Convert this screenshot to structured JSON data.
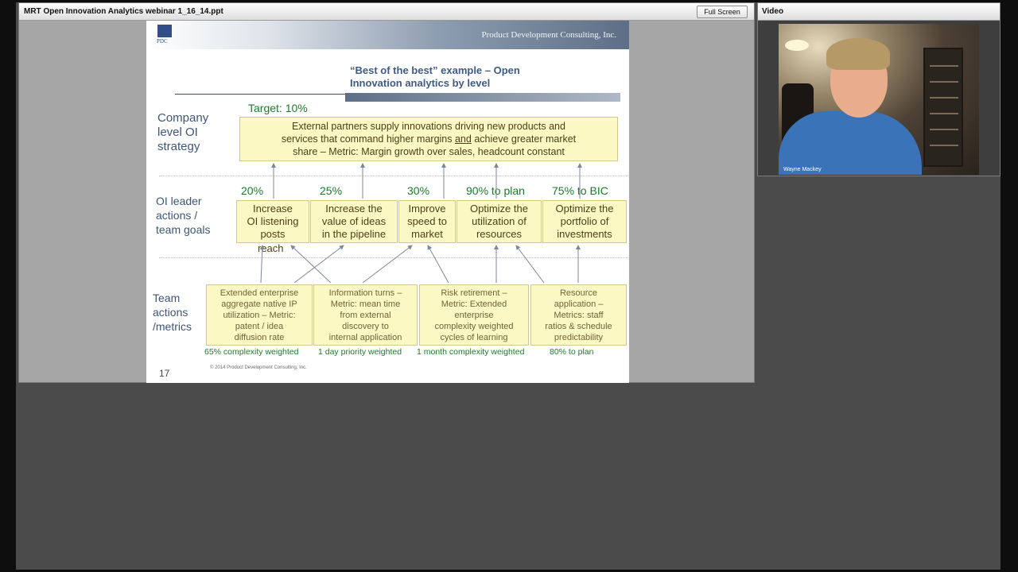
{
  "presentation_pod": {
    "title": "MRT Open Innovation Analytics webinar 1_16_14.ppt",
    "fullscreen_label": "Full Screen"
  },
  "slide": {
    "logo_text": "PDC",
    "company": "Product Development Consulting, Inc.",
    "title_line1": "“Best of the best” example – Open",
    "title_line2": "Innovation analytics by level",
    "row1_label": [
      "Company",
      "level OI",
      "strategy"
    ],
    "row2_label": [
      "OI leader",
      "actions /",
      "team goals"
    ],
    "row3_label": [
      "Team",
      "actions",
      "/metrics"
    ],
    "target": "Target: 10%",
    "strategy_box": [
      "External partners supply innovations driving new products and",
      "services that command higher margins and achieve greater market",
      "share – Metric: Margin growth over sales, headcount constant"
    ],
    "strategy_box_parts": {
      "line2_pre": "services that command higher margins ",
      "line2_underlined": "and",
      "line2_post": " achieve greater market"
    },
    "goal_percents": [
      "20%",
      "25%",
      "30%",
      "90% to plan",
      "75% to BIC"
    ],
    "goal_boxes": [
      [
        "Increase",
        "OI listening",
        "posts"
      ],
      [
        "Increase the",
        "value of ideas",
        "in the pipeline"
      ],
      [
        "Improve",
        "speed to",
        "market"
      ],
      [
        "Optimize the",
        "utilization of",
        "resources"
      ],
      [
        "Optimize the",
        "portfolio of",
        "investments"
      ]
    ],
    "stray_word": "reach",
    "action_boxes": [
      [
        "Extended enterprise",
        "aggregate native IP",
        "utilization – Metric:",
        "patent / idea",
        "diffusion rate"
      ],
      [
        "Information turns –",
        "Metric: mean time",
        "from external",
        "discovery to",
        "internal application"
      ],
      [
        "Risk retirement –",
        "Metric: Extended",
        "enterprise",
        "complexity weighted",
        "cycles of learning"
      ],
      [
        "Resource",
        "application –",
        "Metrics: staff",
        "ratios & schedule",
        "predictability"
      ]
    ],
    "action_metrics": [
      "65% complexity weighted",
      "1 day priority weighted",
      "1 month complexity weighted",
      "80% to plan"
    ],
    "page_number": "17",
    "copyright": "© 2014 Product Development Consulting, Inc."
  },
  "video_pod": {
    "title": "Video",
    "presenter_name": "Wayne Mackey"
  },
  "colors": {
    "box_fill": "#fcf8c4",
    "label_blue": "#3d5675",
    "target_green": "#1d7a2c",
    "header_band": "#5d6f87"
  }
}
